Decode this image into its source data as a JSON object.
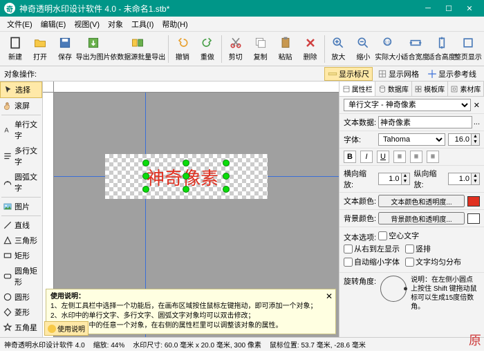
{
  "titlebar": {
    "app": "神奇透明水印设计软件 4.0",
    "doc": "未命名1.stb*"
  },
  "menu": [
    "文件(E)",
    "编辑(E)",
    "视图(V)",
    "对象",
    "工具(I)",
    "帮助(H)"
  ],
  "toolbar": [
    {
      "icon": "new",
      "label": "新建"
    },
    {
      "icon": "open",
      "label": "打开"
    },
    {
      "icon": "save",
      "label": "保存"
    },
    {
      "icon": "export",
      "label": "导出为图片"
    },
    {
      "icon": "batch",
      "label": "依数据源批量导出",
      "wide": true
    },
    {
      "sep": true
    },
    {
      "icon": "undo",
      "label": "撤销"
    },
    {
      "icon": "redo",
      "label": "重做"
    },
    {
      "sep": true
    },
    {
      "icon": "cut",
      "label": "剪切"
    },
    {
      "icon": "copy",
      "label": "复制"
    },
    {
      "icon": "paste",
      "label": "粘贴"
    },
    {
      "icon": "delete",
      "label": "删除"
    },
    {
      "sep": true
    },
    {
      "icon": "zoomin",
      "label": "放大"
    },
    {
      "icon": "zoomout",
      "label": "缩小"
    },
    {
      "icon": "zoom100",
      "label": "实际大小"
    },
    {
      "icon": "fitw",
      "label": "适合宽度"
    },
    {
      "icon": "fith",
      "label": "适合高度"
    },
    {
      "icon": "fitp",
      "label": "整页显示"
    }
  ],
  "secondbar": {
    "label": "对象操作:",
    "toggles": [
      {
        "icon": "ruler",
        "label": "显示标尺",
        "active": true
      },
      {
        "icon": "grid",
        "label": "显示网格",
        "active": false
      },
      {
        "icon": "guide",
        "label": "显示参考线",
        "active": false
      }
    ]
  },
  "sidebar": [
    {
      "icon": "cursor",
      "label": "选择",
      "active": true
    },
    {
      "icon": "hand",
      "label": "滚屏"
    },
    null,
    {
      "icon": "text1",
      "label": "单行文字"
    },
    {
      "icon": "textm",
      "label": "多行文字"
    },
    {
      "icon": "textarc",
      "label": "圆弧文字"
    },
    null,
    {
      "icon": "image",
      "label": "图片"
    },
    null,
    {
      "icon": "line",
      "label": "直线"
    },
    {
      "icon": "tri",
      "label": "三角形"
    },
    {
      "icon": "rect",
      "label": "矩形"
    },
    {
      "icon": "rrect",
      "label": "圆角矩形"
    },
    {
      "icon": "circle",
      "label": "圆形"
    },
    {
      "icon": "diamond",
      "label": "菱形"
    },
    {
      "icon": "star",
      "label": "五角星"
    }
  ],
  "canvas": {
    "text": "神奇像素"
  },
  "tabs": [
    {
      "icon": "prop",
      "label": "属性栏",
      "active": true
    },
    {
      "icon": "db",
      "label": "数据库"
    },
    {
      "icon": "tpl",
      "label": "模板库"
    },
    {
      "icon": "mat",
      "label": "素材库"
    }
  ],
  "props": {
    "objectType": "单行文字 - 神奇像素",
    "textDataLabel": "文本数据:",
    "textData": "神奇像素",
    "fontLabel": "字体:",
    "font": "Tahoma",
    "fontSize": "16.0",
    "hScaleLabel": "横向缩放:",
    "hScale": "1.0",
    "vScaleLabel": "纵向缩放:",
    "vScale": "1.0",
    "textColorLabel": "文本颜色:",
    "textColorBtn": "文本颜色和透明度...",
    "textColor": "#e03020",
    "bgColorLabel": "背景颜色:",
    "bgColorBtn": "背景颜色和透明度...",
    "bgColor": "#ffffff",
    "optionsLabel": "文本选项:",
    "opts": [
      "空心文字",
      "从右到左显示",
      "竖排",
      "自动缩小字体",
      "文字均匀分布"
    ],
    "rotLabel": "旋转角度:",
    "rotDesc": "说明：在左侧小圆点上按住 Shift 键拖动鼠标可以生成15度倍数角。"
  },
  "help": {
    "title": "使用说明：",
    "lines": [
      "1、左侧工具栏中选择一个功能后，在画布区域按住鼠标左键拖动，即可添加一个对象；",
      "2、水印中的单行文字、多行文字、圆弧文字对象均可以双击修改；",
      "3、选择水印中的任意一个对象，在右侧的属性栏里可以调整该对象的属性。"
    ],
    "btn": "使用说明"
  },
  "statusbar": {
    "app": "神奇透明水印设计软件 4.0",
    "zoom": "缩放: 44%",
    "size": "水印尺寸: 60.0 毫米 x 20.0 毫米, 300 像素",
    "mouse": "鼠标位置: 53.7 毫米, -28.6 毫米"
  },
  "corner": "原"
}
